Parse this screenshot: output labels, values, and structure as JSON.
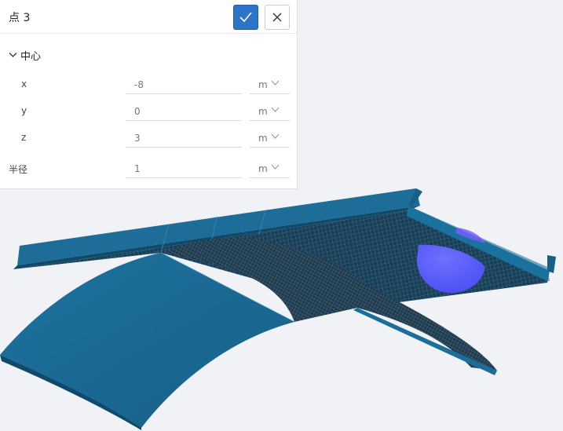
{
  "panel": {
    "title": "点 3",
    "section": "中心",
    "fields": [
      {
        "label": "x",
        "value": "-8",
        "unit": "m"
      },
      {
        "label": "y",
        "value": "0",
        "unit": "m"
      },
      {
        "label": "z",
        "value": "3",
        "unit": "m"
      },
      {
        "label": "半径",
        "value": "1",
        "unit": "m"
      }
    ]
  },
  "icons": {
    "confirm": "check-icon",
    "close": "close-icon",
    "section_toggle": "chevron-down-icon",
    "unit_dropdown": "chevron-down-icon"
  },
  "colors": {
    "surface": "#1b6e99",
    "surface_dark": "#0f4a6b",
    "sphere": "#5a5cff",
    "accent": "#2b74c7"
  }
}
